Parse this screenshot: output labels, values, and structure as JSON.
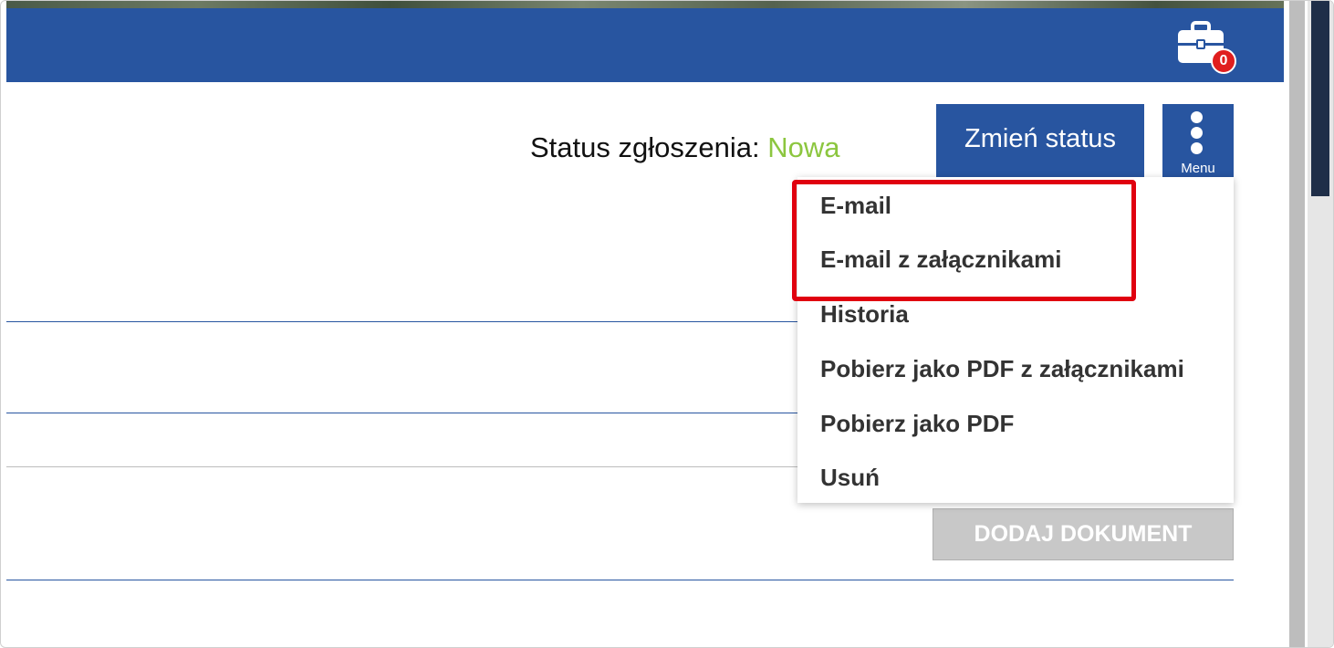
{
  "header": {
    "cart_badge_count": "0",
    "cart_icon": "briefcase-icon",
    "bar_color": "#2855a0"
  },
  "status": {
    "label": "Status zgłoszenia:",
    "value": "Nowa",
    "value_color": "#8cc63f"
  },
  "toolbar": {
    "change_status_label": "Zmień status",
    "menu_label": "Menu",
    "menu_icon": "vertical-dots-icon"
  },
  "dropdown": {
    "items": [
      {
        "label": "E-mail"
      },
      {
        "label": "E-mail z załącznikami"
      },
      {
        "label": "Historia"
      },
      {
        "label": "Pobierz jako PDF z załącznikami"
      },
      {
        "label": "Pobierz jako PDF"
      },
      {
        "label": "Usuń"
      }
    ],
    "highlight_color": "#e0000f"
  },
  "documents": {
    "add_document_label": "DODAJ DOKUMENT"
  }
}
